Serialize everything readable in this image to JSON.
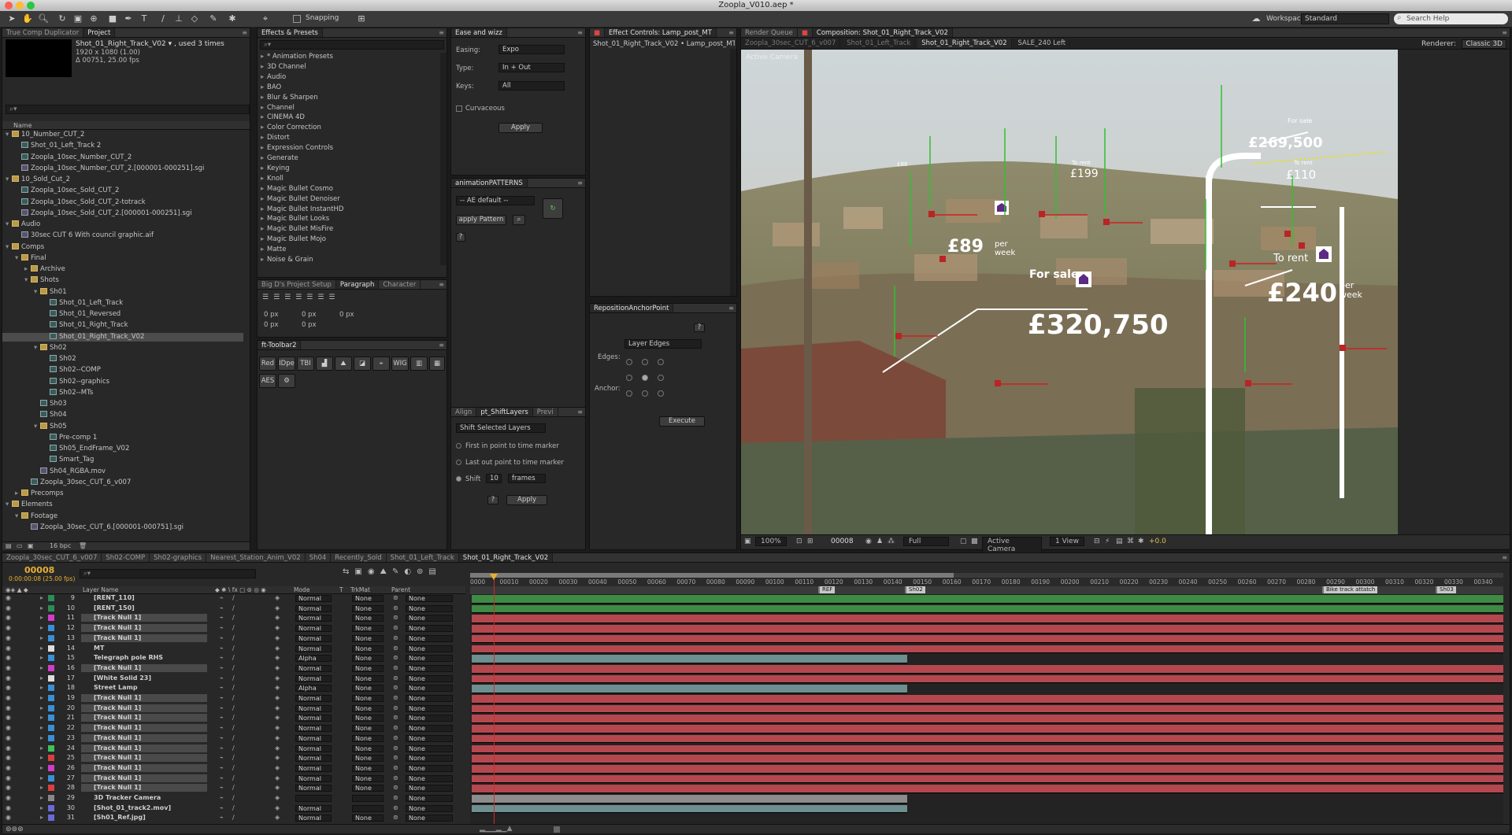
{
  "app": {
    "title": "Zoopla_V010.aep *"
  },
  "toolbar": {
    "snapping_label": "Snapping",
    "workspace_label": "Workspace:",
    "workspace_value": "Standard",
    "search_placeholder": "Search Help"
  },
  "project_panel": {
    "tabs": [
      "True Comp Duplicator",
      "Project"
    ],
    "selected_name": "Shot_01_Right_Track_V02 ▾ , used 3 times",
    "selected_res": "1920 x 1080 (1.00)",
    "selected_dur": "Δ 00751, 25.00 fps",
    "column_name": "Name",
    "bpc": "16 bpc",
    "items": [
      {
        "label": "10_Number_CUT_2",
        "indent": 0,
        "type": "fold",
        "tri": "▾"
      },
      {
        "label": "Shot_01_Left_Track 2",
        "indent": 1,
        "type": "comp",
        "tri": ""
      },
      {
        "label": "Zoopla_10sec_Number_CUT_2",
        "indent": 1,
        "type": "comp",
        "tri": ""
      },
      {
        "label": "Zoopla_10sec_Number_CUT_2.[000001-000251].sgi",
        "indent": 1,
        "type": "footage",
        "tri": ""
      },
      {
        "label": "10_Sold_Cut_2",
        "indent": 0,
        "type": "fold",
        "tri": "▾"
      },
      {
        "label": "Zoopla_10sec_Sold_CUT_2",
        "indent": 1,
        "type": "comp",
        "tri": ""
      },
      {
        "label": "Zoopla_10sec_Sold_CUT_2-totrack",
        "indent": 1,
        "type": "comp",
        "tri": ""
      },
      {
        "label": "Zoopla_10sec_Sold_CUT_2.[000001-000251].sgi",
        "indent": 1,
        "type": "footage",
        "tri": ""
      },
      {
        "label": "Audio",
        "indent": 0,
        "type": "fold",
        "tri": "▾"
      },
      {
        "label": "30sec CUT 6 With council graphic.aif",
        "indent": 1,
        "type": "footage",
        "tri": ""
      },
      {
        "label": "Comps",
        "indent": 0,
        "type": "fold",
        "tri": "▾"
      },
      {
        "label": "Final",
        "indent": 1,
        "type": "fold",
        "tri": "▾"
      },
      {
        "label": "Archive",
        "indent": 2,
        "type": "fold",
        "tri": "▸"
      },
      {
        "label": "Shots",
        "indent": 2,
        "type": "fold",
        "tri": "▾"
      },
      {
        "label": "Sh01",
        "indent": 3,
        "type": "fold",
        "tri": "▾"
      },
      {
        "label": "Shot_01_Left_Track",
        "indent": 4,
        "type": "comp",
        "tri": ""
      },
      {
        "label": "Shot_01_Reversed",
        "indent": 4,
        "type": "comp",
        "tri": ""
      },
      {
        "label": "Shot_01_Right_Track",
        "indent": 4,
        "type": "comp",
        "tri": ""
      },
      {
        "label": "Shot_01_Right_Track_V02",
        "indent": 4,
        "type": "comp",
        "tri": "",
        "selected": true
      },
      {
        "label": "Sh02",
        "indent": 3,
        "type": "fold",
        "tri": "▾"
      },
      {
        "label": "Sh02",
        "indent": 4,
        "type": "comp",
        "tri": ""
      },
      {
        "label": "Sh02--COMP",
        "indent": 4,
        "type": "comp",
        "tri": ""
      },
      {
        "label": "Sh02--graphics",
        "indent": 4,
        "type": "comp",
        "tri": ""
      },
      {
        "label": "Sh02--MTs",
        "indent": 4,
        "type": "comp",
        "tri": ""
      },
      {
        "label": "Sh03",
        "indent": 3,
        "type": "comp",
        "tri": ""
      },
      {
        "label": "Sh04",
        "indent": 3,
        "type": "comp",
        "tri": ""
      },
      {
        "label": "Sh05",
        "indent": 3,
        "type": "fold",
        "tri": "▾"
      },
      {
        "label": "Pre-comp 1",
        "indent": 4,
        "type": "comp",
        "tri": ""
      },
      {
        "label": "Sh05_EndFrame_V02",
        "indent": 4,
        "type": "comp",
        "tri": ""
      },
      {
        "label": "Smart_Tag",
        "indent": 4,
        "type": "comp",
        "tri": ""
      },
      {
        "label": "Sh04_RGBA.mov",
        "indent": 3,
        "type": "footage",
        "tri": ""
      },
      {
        "label": "Zoopla_30sec_CUT_6_v007",
        "indent": 2,
        "type": "comp",
        "tri": ""
      },
      {
        "label": "Precomps",
        "indent": 1,
        "type": "fold",
        "tri": "▸"
      },
      {
        "label": "Elements",
        "indent": 0,
        "type": "fold",
        "tri": "▾"
      },
      {
        "label": "Footage",
        "indent": 1,
        "type": "fold",
        "tri": "▾"
      },
      {
        "label": "Zoopla_30sec_CUT_6.[000001-000751].sgi",
        "indent": 2,
        "type": "footage",
        "tri": ""
      }
    ]
  },
  "effects_panel": {
    "tab": "Effects & Presets",
    "items": [
      "* Animation Presets",
      "3D Channel",
      "Audio",
      "BAO",
      "Blur & Sharpen",
      "Channel",
      "CINEMA 4D",
      "Color Correction",
      "Distort",
      "Expression Controls",
      "Generate",
      "Keying",
      "Knoll",
      "Magic Bullet Cosmo",
      "Magic Bullet Denoiser",
      "Magic Bullet InstantHD",
      "Magic Bullet Looks",
      "Magic Bullet MisFire",
      "Magic Bullet Mojo",
      "Matte",
      "Noise & Grain"
    ]
  },
  "paragraph_panel": {
    "tabs": [
      "Big D's Project Setup",
      "Paragraph",
      "Character"
    ],
    "values": [
      "0 px",
      "0 px",
      "0 px",
      "0 px",
      "0 px"
    ]
  },
  "ft_toolbar": {
    "tab": "ft-Toolbar2",
    "buttons": [
      "Red",
      "IDpe",
      "TBI",
      "WIG",
      "AES"
    ]
  },
  "ease_panel": {
    "tab": "Ease and wizz",
    "easing_label": "Easing:",
    "easing_value": "Expo",
    "type_label": "Type:",
    "type_value": "In + Out",
    "keys_label": "Keys:",
    "keys_value": "All",
    "curvaceous": "Curvaceous",
    "apply": "Apply"
  },
  "anim_patterns": {
    "tab": "animationPATTERNS",
    "select": "-- AE default --",
    "apply": "apply Pattern",
    "help": "?"
  },
  "shift_panel": {
    "tabs": [
      "Align",
      "pt_ShiftLayers",
      "Previ"
    ],
    "select": "Shift Selected Layers",
    "opt1": "First in point to time marker",
    "opt2": "Last out point to time marker",
    "shift_label": "Shift",
    "shift_value": "10",
    "unit": "frames",
    "help": "?",
    "apply": "Apply"
  },
  "effect_controls": {
    "tab": "Effect Controls: Lamp_post_MT",
    "subtitle": "Shot_01_Right_Track_V02 • Lamp_post_MT"
  },
  "reposition": {
    "tab": "RepositionAnchorPoint",
    "help": "?",
    "select": "Layer Edges",
    "edges": "Edges:",
    "anchor": "Anchor:",
    "execute": "Execute"
  },
  "composition": {
    "tabs": [
      "Render Queue",
      "Composition: Shot_01_Right_Track_V02"
    ],
    "breadcrumbs": [
      "Zoopla_30sec_CUT_6_v007",
      "Shot_01_Left_Track",
      "Shot_01_Right_Track_V02",
      "SALE_240 Left"
    ],
    "renderer_label": "Renderer:",
    "renderer_value": "Classic 3D",
    "active_camera": "Active Camera",
    "overlays": {
      "price1": "£320,750",
      "for_sale1": "For sale",
      "price2": "£240",
      "per_week2": "per week",
      "to_rent2": "To rent",
      "price3": "£269,500",
      "for_sale3": "For sale",
      "price4": "£89",
      "per_week4": "per week",
      "price5": "£199",
      "to_rent5": "To rent",
      "price6": "£110",
      "to_rent6": "To rent",
      "price7": "£89"
    },
    "footer": {
      "zoom": "100%",
      "timecode": "00008",
      "resolution": "Full",
      "camera": "Active Camera",
      "views": "1 View",
      "exposure": "+0.0"
    }
  },
  "timeline": {
    "tabs": [
      "Zoopla_30sec_CUT_6_v007",
      "Sh02-COMP",
      "Sh02-graphics",
      "Nearest_Station_Anim_V02",
      "Sh04",
      "Recently_Sold",
      "Shot_01_Left_Track",
      "Shot_01_Right_Track_V02"
    ],
    "current_frame": "00008",
    "current_tc": "0:00:00:08 (25.00 fps)",
    "headers": {
      "layer_name": "Layer Name",
      "mode": "Mode",
      "t": "T",
      "trkmat": "TrkMat",
      "parent": "Parent"
    },
    "ruler": [
      "0000",
      "00010",
      "00020",
      "00030",
      "00040",
      "00050",
      "00060",
      "00070",
      "00080",
      "00090",
      "00100",
      "00110",
      "00120",
      "00130",
      "00140",
      "00150",
      "00160",
      "00170",
      "00180",
      "00190",
      "00200",
      "00210",
      "00220",
      "00230",
      "00240",
      "00250",
      "00260",
      "00270",
      "00280",
      "00290",
      "00300",
      "00310",
      "00320",
      "00330",
      "00340"
    ],
    "markers": [
      "REF",
      "Sh02",
      "Bike track attatch",
      "Sh03"
    ],
    "layers": [
      {
        "num": "9",
        "name": "[RENT_110]",
        "color": "#2e8b57",
        "mode": "Normal",
        "trk": "None",
        "parent": "None",
        "bar": "#3f8a44",
        "end": 1.0
      },
      {
        "num": "10",
        "name": "[RENT_150]",
        "color": "#2e8b57",
        "mode": "Normal",
        "trk": "None",
        "parent": "None",
        "bar": "#3f8a44",
        "end": 1.0
      },
      {
        "num": "11",
        "name": "[Track Null 1]",
        "color": "#d23cc8",
        "mode": "Normal",
        "trk": "None",
        "parent": "None",
        "bar": "#b5484f",
        "end": 1.0
      },
      {
        "num": "12",
        "name": "[Track Null 1]",
        "color": "#3a8fd6",
        "mode": "Normal",
        "trk": "None",
        "parent": "None",
        "bar": "#b5484f",
        "end": 1.0
      },
      {
        "num": "13",
        "name": "[Track Null 1]",
        "color": "#3a8fd6",
        "mode": "Normal",
        "trk": "None",
        "parent": "None",
        "bar": "#b5484f",
        "end": 1.0
      },
      {
        "num": "14",
        "name": "MT",
        "color": "#dddddd",
        "mode": "Normal",
        "trk": "None",
        "parent": "None",
        "bar": "#b5484f",
        "end": 1.0
      },
      {
        "num": "15",
        "name": "Telegraph pole RHS",
        "color": "#3a8fd6",
        "mode": "Alpha",
        "trk": "None",
        "parent": "None",
        "bar": "#6e8f8f",
        "end": 0.422
      },
      {
        "num": "16",
        "name": "[Track Null 1]",
        "color": "#d23cc8",
        "mode": "Normal",
        "trk": "None",
        "parent": "None",
        "bar": "#b5484f",
        "end": 1.0
      },
      {
        "num": "17",
        "name": "[White Solid 23]",
        "color": "#dddddd",
        "mode": "Normal",
        "trk": "None",
        "parent": "None",
        "bar": "#b5484f",
        "end": 1.0
      },
      {
        "num": "18",
        "name": "Street Lamp",
        "color": "#3a8fd6",
        "mode": "Alpha",
        "trk": "None",
        "parent": "None",
        "bar": "#6e8f8f",
        "end": 0.422
      },
      {
        "num": "19",
        "name": "[Track Null 1]",
        "color": "#3a8fd6",
        "mode": "Normal",
        "trk": "None",
        "parent": "None",
        "bar": "#b5484f",
        "end": 1.0
      },
      {
        "num": "20",
        "name": "[Track Null 1]",
        "color": "#3a8fd6",
        "mode": "Normal",
        "trk": "None",
        "parent": "None",
        "bar": "#b5484f",
        "end": 1.0
      },
      {
        "num": "21",
        "name": "[Track Null 1]",
        "color": "#3a8fd6",
        "mode": "Normal",
        "trk": "None",
        "parent": "None",
        "bar": "#b5484f",
        "end": 1.0
      },
      {
        "num": "22",
        "name": "[Track Null 1]",
        "color": "#3a8fd6",
        "mode": "Normal",
        "trk": "None",
        "parent": "None",
        "bar": "#b5484f",
        "end": 1.0
      },
      {
        "num": "23",
        "name": "[Track Null 1]",
        "color": "#3a8fd6",
        "mode": "Normal",
        "trk": "None",
        "parent": "None",
        "bar": "#b5484f",
        "end": 1.0
      },
      {
        "num": "24",
        "name": "[Track Null 1]",
        "color": "#40c060",
        "mode": "Normal",
        "trk": "None",
        "parent": "None",
        "bar": "#b5484f",
        "end": 1.0
      },
      {
        "num": "25",
        "name": "[Track Null 1]",
        "color": "#d84040",
        "mode": "Normal",
        "trk": "None",
        "parent": "None",
        "bar": "#b5484f",
        "end": 1.0
      },
      {
        "num": "26",
        "name": "[Track Null 1]",
        "color": "#d23cc8",
        "mode": "Normal",
        "trk": "None",
        "parent": "None",
        "bar": "#b5484f",
        "end": 1.0
      },
      {
        "num": "27",
        "name": "[Track Null 1]",
        "color": "#3a8fd6",
        "mode": "Normal",
        "trk": "None",
        "parent": "None",
        "bar": "#b5484f",
        "end": 1.0
      },
      {
        "num": "28",
        "name": "[Track Null 1]",
        "color": "#d84040",
        "mode": "Normal",
        "trk": "None",
        "parent": "None",
        "bar": "#b5484f",
        "end": 1.0
      },
      {
        "num": "29",
        "name": "3D Tracker Camera",
        "color": "#888888",
        "mode": "",
        "trk": "",
        "parent": "None",
        "bar": "#8c8c8c",
        "end": 0.422
      },
      {
        "num": "30",
        "name": "[Shot_01_track2.mov]",
        "color": "#6a6ad6",
        "mode": "Normal",
        "trk": "",
        "parent": "None",
        "bar": "#6e8f8f",
        "end": 0.422
      },
      {
        "num": "31",
        "name": "[Sh01_Ref.jpg]",
        "color": "#6a6ad6",
        "mode": "Normal",
        "trk": "None",
        "parent": "None",
        "bar": "#2a2a2a",
        "end": 0.0
      }
    ]
  }
}
